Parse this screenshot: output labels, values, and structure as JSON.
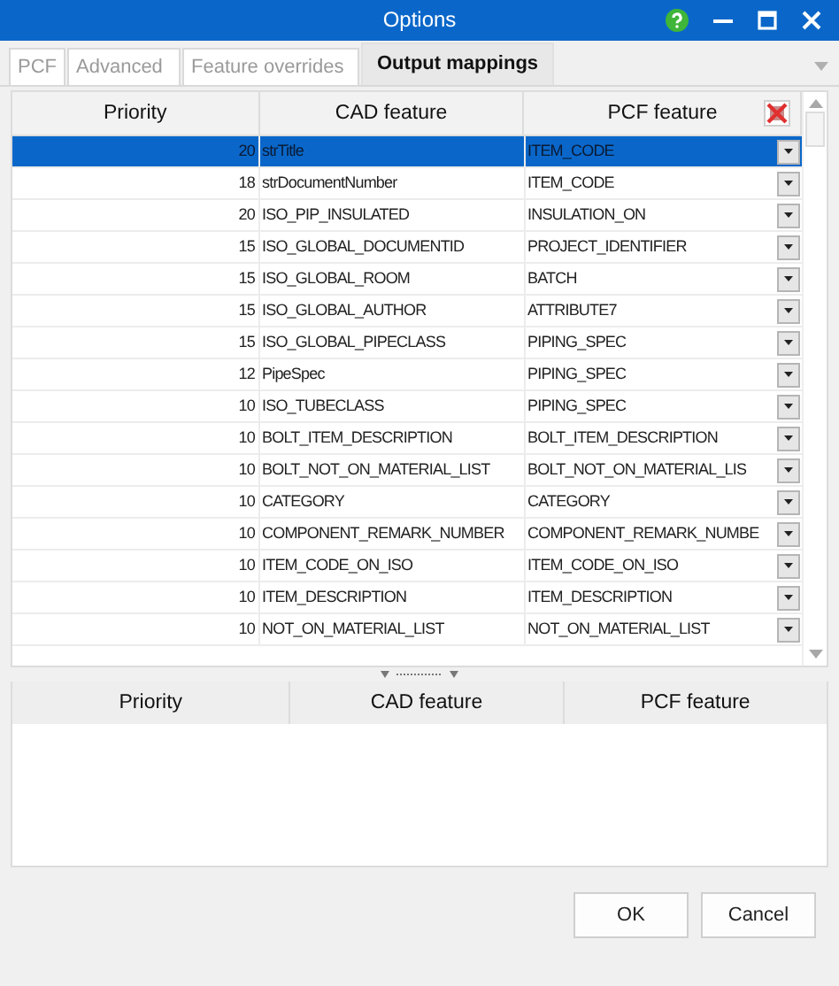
{
  "window": {
    "title": "Options"
  },
  "tabs": [
    {
      "label": "PCF",
      "selected": false
    },
    {
      "label": "Advanced",
      "selected": false
    },
    {
      "label": "Feature overrides",
      "selected": false
    },
    {
      "label": "Output mappings",
      "selected": true
    }
  ],
  "mappings": {
    "columns": [
      "Priority",
      "CAD feature",
      "PCF feature"
    ],
    "rows": [
      {
        "priority": "20",
        "cad_feature": "strTitle",
        "pcf_feature": "ITEM_CODE",
        "selected": true
      },
      {
        "priority": "18",
        "cad_feature": "strDocumentNumber",
        "pcf_feature": "ITEM_CODE",
        "selected": false
      },
      {
        "priority": "20",
        "cad_feature": "ISO_PIP_INSULATED",
        "pcf_feature": "INSULATION_ON",
        "selected": false
      },
      {
        "priority": "15",
        "cad_feature": "ISO_GLOBAL_DOCUMENTID",
        "pcf_feature": "PROJECT_IDENTIFIER",
        "selected": false
      },
      {
        "priority": "15",
        "cad_feature": "ISO_GLOBAL_ROOM",
        "pcf_feature": "BATCH",
        "selected": false
      },
      {
        "priority": "15",
        "cad_feature": "ISO_GLOBAL_AUTHOR",
        "pcf_feature": "ATTRIBUTE7",
        "selected": false
      },
      {
        "priority": "15",
        "cad_feature": "ISO_GLOBAL_PIPECLASS",
        "pcf_feature": "PIPING_SPEC",
        "selected": false
      },
      {
        "priority": "12",
        "cad_feature": "PipeSpec",
        "pcf_feature": "PIPING_SPEC",
        "selected": false
      },
      {
        "priority": "10",
        "cad_feature": "ISO_TUBECLASS",
        "pcf_feature": "PIPING_SPEC",
        "selected": false
      },
      {
        "priority": "10",
        "cad_feature": "BOLT_ITEM_DESCRIPTION",
        "pcf_feature": "BOLT_ITEM_DESCRIPTION",
        "selected": false
      },
      {
        "priority": "10",
        "cad_feature": "BOLT_NOT_ON_MATERIAL_LIST",
        "pcf_feature": "BOLT_NOT_ON_MATERIAL_LIS",
        "selected": false
      },
      {
        "priority": "10",
        "cad_feature": "CATEGORY",
        "pcf_feature": "CATEGORY",
        "selected": false
      },
      {
        "priority": "10",
        "cad_feature": "COMPONENT_REMARK_NUMBER",
        "pcf_feature": "COMPONENT_REMARK_NUMBE",
        "selected": false
      },
      {
        "priority": "10",
        "cad_feature": "ITEM_CODE_ON_ISO",
        "pcf_feature": "ITEM_CODE_ON_ISO",
        "selected": false
      },
      {
        "priority": "10",
        "cad_feature": "ITEM_DESCRIPTION",
        "pcf_feature": "ITEM_DESCRIPTION",
        "selected": false
      },
      {
        "priority": "10",
        "cad_feature": "NOT_ON_MATERIAL_LIST",
        "pcf_feature": "NOT_ON_MATERIAL_LIST",
        "selected": false
      }
    ]
  },
  "details": {
    "columns": [
      "Priority",
      "CAD feature",
      "PCF feature"
    ]
  },
  "buttons": [
    "OK",
    "Cancel"
  ]
}
